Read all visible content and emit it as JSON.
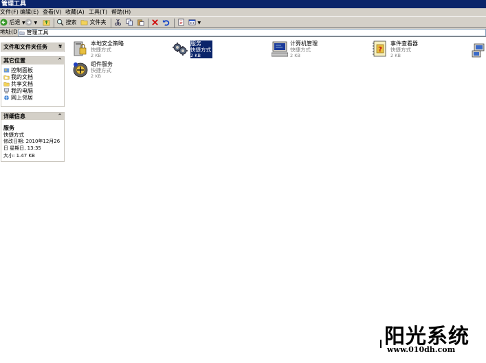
{
  "window": {
    "title": "管理工具"
  },
  "menu": [
    "文件(F)",
    "编辑(E)",
    "查看(V)",
    "收藏(A)",
    "工具(T)",
    "帮助(H)"
  ],
  "toolbar": {
    "back_label": "后退",
    "search_label": "搜索",
    "folders_label": "文件夹"
  },
  "address": {
    "label": "地址(D)",
    "value": "管理工具"
  },
  "left": {
    "tasks": {
      "title": "文件和文件夹任务"
    },
    "places": {
      "title": "其它位置",
      "links": [
        "控制面板",
        "我的文档",
        "共享文档",
        "我的电脑",
        "网上邻居"
      ]
    },
    "details": {
      "title": "详细信息",
      "name": "服务",
      "type": "快捷方式",
      "modified": "修改日期: 2010年12月26日 星期日, 13:35",
      "size": "大小: 1.47 KB"
    }
  },
  "items": [
    {
      "name": "本地安全策略",
      "type": "快捷方式",
      "size": "2 KB",
      "icon": "security-policy-icon"
    },
    {
      "name": "服务",
      "type": "快捷方式",
      "size": "2 KB",
      "icon": "services-gears-icon",
      "selected": true
    },
    {
      "name": "计算机管理",
      "type": "快捷方式",
      "size": "2 KB",
      "icon": "computer-management-icon"
    },
    {
      "name": "事件查看器",
      "type": "快捷方式",
      "size": "2 KB",
      "icon": "event-viewer-icon"
    },
    {
      "name": "组件服务",
      "type": "快捷方式",
      "size": "2 KB",
      "icon": "component-services-icon"
    }
  ],
  "watermark": {
    "title": "阳光系统",
    "url": "www.010dh.com"
  }
}
